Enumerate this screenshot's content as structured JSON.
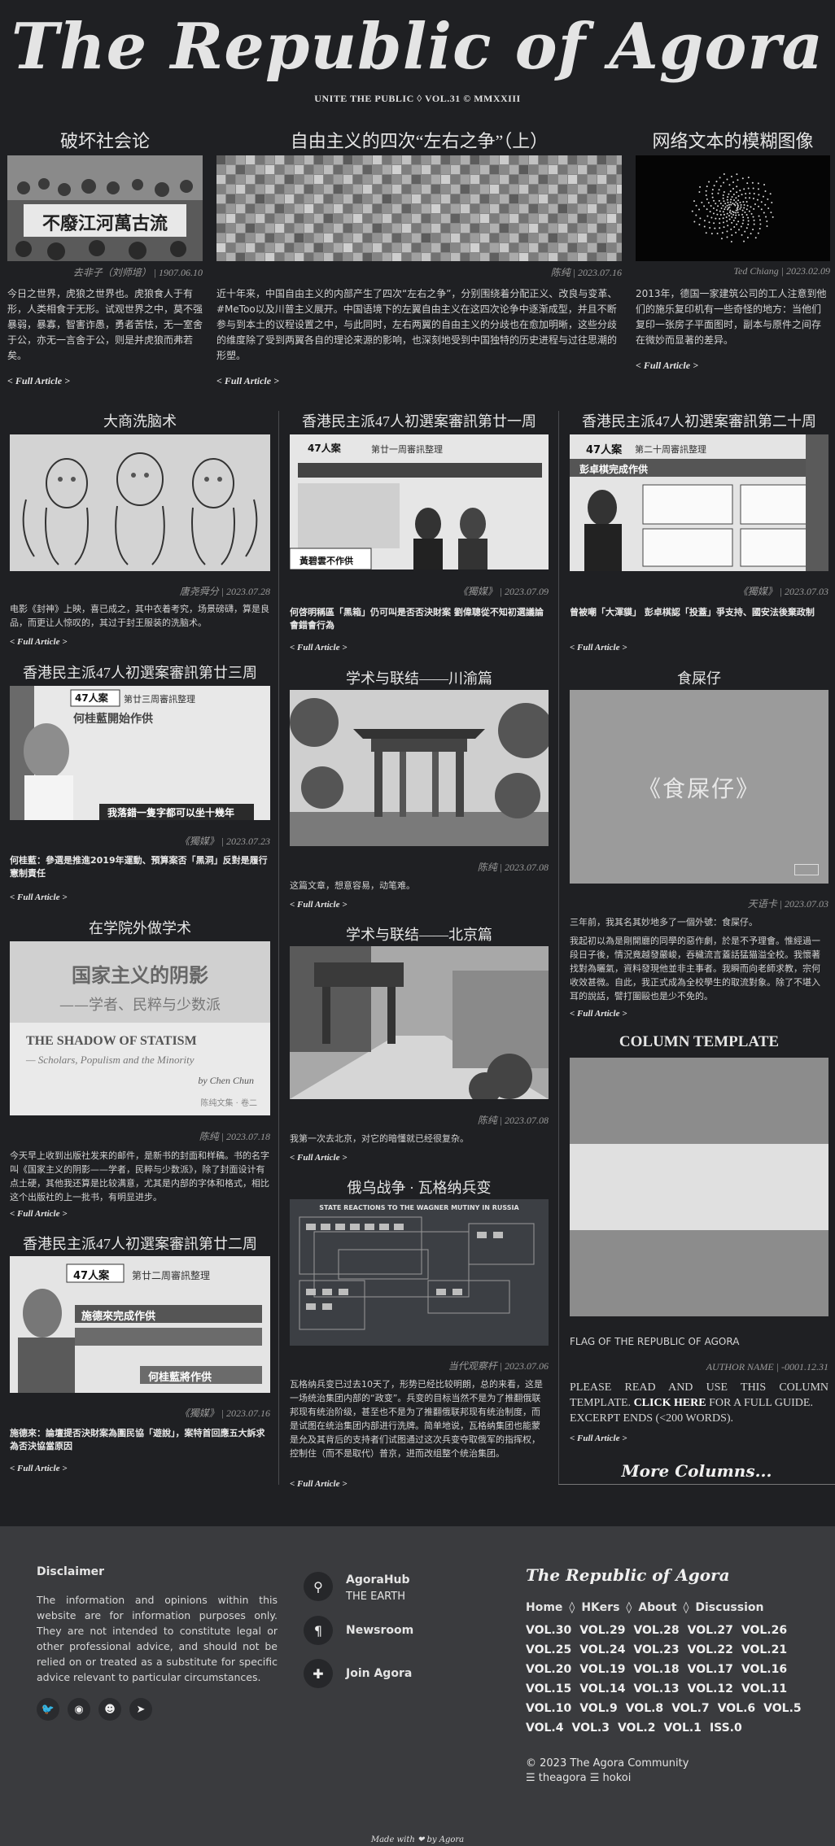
{
  "masthead": {
    "title": "The Republic of Agora",
    "subtitle": "UNITE THE PUBLIC ◊ VOL.31 © MMXXIII"
  },
  "top": [
    {
      "title": "破坏社会论",
      "meta": "去非子（刘师培） | 1907.06.10",
      "excerpt": "今日之世界，虎狼之世界也。虎狼食人于有形，人类相食于无形。试观世界之中，莫不强暴弱，暴寡，智害诈愚，勇者苦怯，无一室舍于公，亦无一言舍于公，则是并虎狼而弗若矣。",
      "more": "< Full Article >",
      "banner": "不廢江河萬古流"
    },
    {
      "title": "自由主义的四次“左右之争”（上）",
      "meta": "陈纯 | 2023.07.16",
      "excerpt": "近十年来，中国自由主义的内部产生了四次“左右之争”，分别围绕着分配正义、改良与变革、#MeToo以及川普主义展开。中国语境下的左翼自由主义在这四次论争中逐渐成型，并且不断参与到本土的议程设置之中，与此同时，左右两翼的自由主义的分歧也在愈加明晰，这些分歧的维度除了受到两翼各自的理论来源的影响，也深刻地受到中国独特的历史进程与过往思潮的形塑。",
      "more": "< Full Article >"
    },
    {
      "title": "网络文本的模糊图像",
      "meta": "Ted Chiang | 2023.02.09",
      "excerpt": "2013年，德国一家建筑公司的工人注意到他们的施乐复印机有一些奇怪的地方：当他们复印一张房子平面图时，副本与原件之间存在微妙而显著的差异。",
      "more": "< Full Article >"
    }
  ],
  "col1": [
    {
      "title": "大商洗脑术",
      "meta": "唐尧舜分 | 2023.07.28",
      "excerpt": "电影《封神》上映，喜已成之，其中衣着考究，场景磅礴，算是良品，而更让人惊叹的，其过于封王服装的洗脑术。",
      "more": "< Full Article >"
    },
    {
      "title": "香港民主派47人初選案審訊第廿三周",
      "meta": "《獨媒》 | 2023.07.23",
      "headline": "何桂藍：參選是推進2019年運動、預算案否「黑洞」反對是履行憲制責任",
      "more": "< Full Article >",
      "img": {
        "badge": "47人案",
        "week": "第廿三周審訊整理",
        "name": "何桂藍開始作供",
        "tag": "我落錯一隻字都可以坐十幾年"
      }
    },
    {
      "title": "在学院外做学术",
      "meta": "陈纯 | 2023.07.18",
      "excerpt": "今天早上收到出版社发来的邮件，是新书的封面和样稿。书的名字叫《国家主义的阴影——学者，民粹与少数派》，除了封面设计有点土硬，其他我还算是比较满意，尤其是内部的字体和格式，相比这个出版社的上一批书，有明显进步。",
      "more": "< Full Article >",
      "book": {
        "cn": "国家主义的阴影",
        "cn2": "——学者、民粹与少数派",
        "en": "THE SHADOW OF STATISM",
        "en2": "— Scholars, Populism and the Minority",
        "by": "by Chen Chun",
        "series": "陈纯文集 · 卷二"
      }
    },
    {
      "title": "香港民主派47人初選案審訊第廿二周",
      "meta": "《獨媒》 | 2023.07.16",
      "headline": "施德來：論壇提否決財案為圍民協「遊說」，案特首回應五大訴求為否決協當原因",
      "more": "< Full Article >",
      "img": {
        "badge": "47人案",
        "week": "第廿二周審訊整理",
        "name": "施德來完成作供",
        "tag": "何桂藍將作供"
      }
    }
  ],
  "col2": [
    {
      "title": "香港民主派47人初選案審訊第廿一周",
      "meta": "《獨媒》 | 2023.07.09",
      "headline": "何啓明稱區「黑箱」仍可叫是否否決財案 劉偉聰從不知初選議論會錯會行為",
      "more": "< Full Article >",
      "img": {
        "badge": "47人案",
        "week": "第廿一周審訊整理",
        "name": "黃碧雲不作供"
      }
    },
    {
      "title": "学术与联结——川渝篇",
      "meta": "陈纯 | 2023.07.08",
      "excerpt": "这篇文章，想意容易，动笔难。",
      "more": "< Full Article >"
    },
    {
      "title": "学术与联结——北京篇",
      "meta": "陈纯 | 2023.07.08",
      "excerpt": "我第一次去北京，对它的暗懂就已经很复杂。",
      "more": "< Full Article >"
    },
    {
      "title": "俄乌战争 · 瓦格纳兵变",
      "meta": "当代观察杆 | 2023.07.06",
      "excerpt": "瓦格纳兵变已过去10天了，形势已经比较明朗，总的来看，这是一场统治集团内部的“政变”。兵变的目标当然不是为了推翻俄联邦现有统治阶级，甚至也不是为了推翻俄联邦现有统治制度，而是试图在统治集团内部进行洗牌。简单地说，瓦格纳集团也能蒙是允及其背后的支持者们试图通过这次兵变夺取俄军的指挥权，控制住（而不是取代）普京，进而改组整个统治集团。",
      "more": "< Full Article >",
      "chart": {
        "title": "STATE REACTIONS TO THE WAGNER MUTINY IN RUSSIA"
      }
    }
  ],
  "col3": [
    {
      "title": "香港民主派47人初選案審訊第二十周",
      "meta": "《獨媒》 | 2023.07.03",
      "headline": "曾被嘲「大渾貘」 彭卓棋認「投蓋」爭支持、國安法後棄政制",
      "more": "< Full Article >",
      "img": {
        "badge": "47人案",
        "week": "第二十周審訊整理",
        "name": "彭卓棋完成作供"
      }
    },
    {
      "title": "食屎仔",
      "meta": "天语卡 | 2023.07.03",
      "excerpt": "三年前，我其名其妙地多了一個外號：食屎仔。",
      "excerpt2": "我起初以為是剛開廳的同學的惡作劇，於是不予理會。惟經過一段日子後，情況竟越發嚴峻，吞穢流言蓋話猛猫溢全校。我懷著找對為曬氣，資料發現他並非主事者。我瞬而向老師求教，宗何收效甚微。自此，我正式成為全校學生的取流對象。除了不堪入耳的說話，譬打圍毆也是少不免的。",
      "more": "< Full Article >",
      "cover": "《食屎仔》"
    },
    {
      "title": "COLUMN TEMPLATE",
      "caption": "FLAG OF THE REPUBLIC OF AGORA",
      "meta": "AUTHOR NAME | -0001.12.31",
      "body_pre": "PLEASE READ AND USE THIS COLUMN TEMPLATE.",
      "body_link": "CLICK HERE",
      "body_post": "FOR A FULL GUIDE.",
      "body2": "EXCERPT ENDS (<200 WORDS).",
      "more": "< Full Article >"
    }
  ],
  "more_columns": "More Columns...",
  "footer": {
    "disclaimer_title": "Disclaimer",
    "disclaimer_text": "The information and opinions within this website are for information purposes only. They are not intended to constitute legal or other professional advice, and should not be relied on or treated as a substitute for specific advice relevant to particular circumstances.",
    "contacts": [
      {
        "title": "AgoraHub",
        "sub": "THE EARTH",
        "icon": "map-pin-icon"
      },
      {
        "title": "Newsroom",
        "sub": "",
        "icon": "paragraph-icon"
      },
      {
        "title": "Join Agora",
        "sub": "",
        "icon": "puzzle-icon"
      }
    ],
    "brand": "The Republic of Agora",
    "nav": [
      "Home",
      "HKers",
      "About",
      "Discussion"
    ],
    "volumes": [
      [
        "VOL.30",
        "VOL.29",
        "VOL.28",
        "VOL.27",
        "VOL.26"
      ],
      [
        "VOL.25",
        "VOL.24",
        "VOL.23",
        "VOL.22",
        "VOL.21"
      ],
      [
        "VOL.20",
        "VOL.19",
        "VOL.18",
        "VOL.17",
        "VOL.16"
      ],
      [
        "VOL.15",
        "VOL.14",
        "VOL.13",
        "VOL.12",
        "VOL.11"
      ],
      [
        "VOL.10",
        "VOL.9",
        "VOL.8",
        "VOL.7",
        "VOL.6",
        "VOL.5"
      ],
      [
        "VOL.4",
        "VOL.3",
        "VOL.2",
        "VOL.1",
        "ISS.0"
      ]
    ],
    "copyright": "© 2023 The Agora Community",
    "credits": "☰ theagora ☰ hokoi",
    "made_with": "Made with ❤ by Agora"
  }
}
